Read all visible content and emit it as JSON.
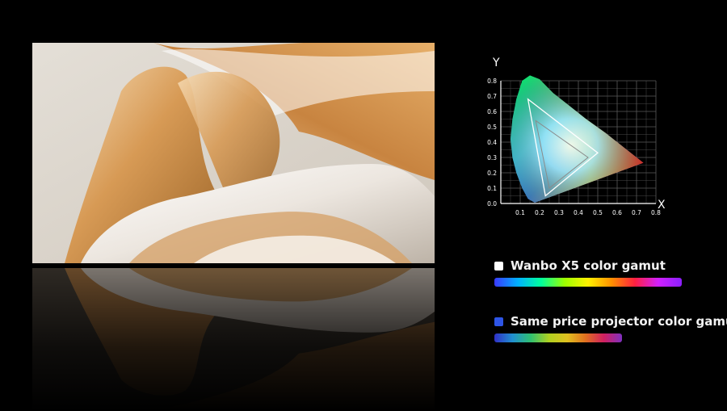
{
  "chart_data": {
    "type": "scatter",
    "xlabel": "X",
    "ylabel": "Y",
    "xlim": [
      0,
      0.8
    ],
    "ylim": [
      0,
      0.8
    ],
    "x_ticks": [
      "0.1",
      "0.2",
      "0.3",
      "0.4",
      "0.5",
      "0.6",
      "0.7",
      "0.8"
    ],
    "y_ticks": [
      "0.0",
      "0.1",
      "0.2",
      "0.3",
      "0.4",
      "0.5",
      "0.6",
      "0.7",
      "0.8"
    ],
    "grid": true,
    "series": [
      {
        "name": "Wanbo X5 color gamut",
        "x": [
          0.14,
          0.23,
          0.5
        ],
        "y": [
          0.68,
          0.05,
          0.33
        ]
      },
      {
        "name": "Same price projector color gamut",
        "x": [
          0.18,
          0.25,
          0.45
        ],
        "y": [
          0.54,
          0.1,
          0.3
        ]
      }
    ]
  },
  "legend": [
    {
      "label": "Wanbo X5 color gamut",
      "swatch_color": "#ffffff"
    },
    {
      "label": "Same price projector color gamut",
      "swatch_color": "#2e55e6"
    }
  ],
  "colors": {
    "background": "#000000",
    "grid": "#5a5a5a"
  }
}
